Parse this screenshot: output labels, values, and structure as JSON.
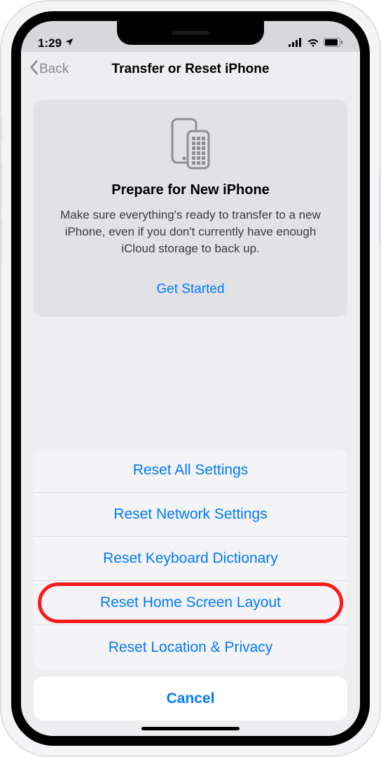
{
  "status": {
    "time": "1:29",
    "location_arrow": "↗"
  },
  "nav": {
    "back_label": "Back",
    "title": "Transfer or Reset iPhone"
  },
  "card": {
    "title": "Prepare for New iPhone",
    "description": "Make sure everything's ready to transfer to a new iPhone, even if you don't currently have enough iCloud storage to back up.",
    "link": "Get Started"
  },
  "sheet": {
    "items": [
      {
        "label": "Reset All Settings"
      },
      {
        "label": "Reset Network Settings"
      },
      {
        "label": "Reset Keyboard Dictionary"
      },
      {
        "label": "Reset Home Screen Layout"
      },
      {
        "label": "Reset Location & Privacy"
      }
    ],
    "cancel": "Cancel"
  }
}
